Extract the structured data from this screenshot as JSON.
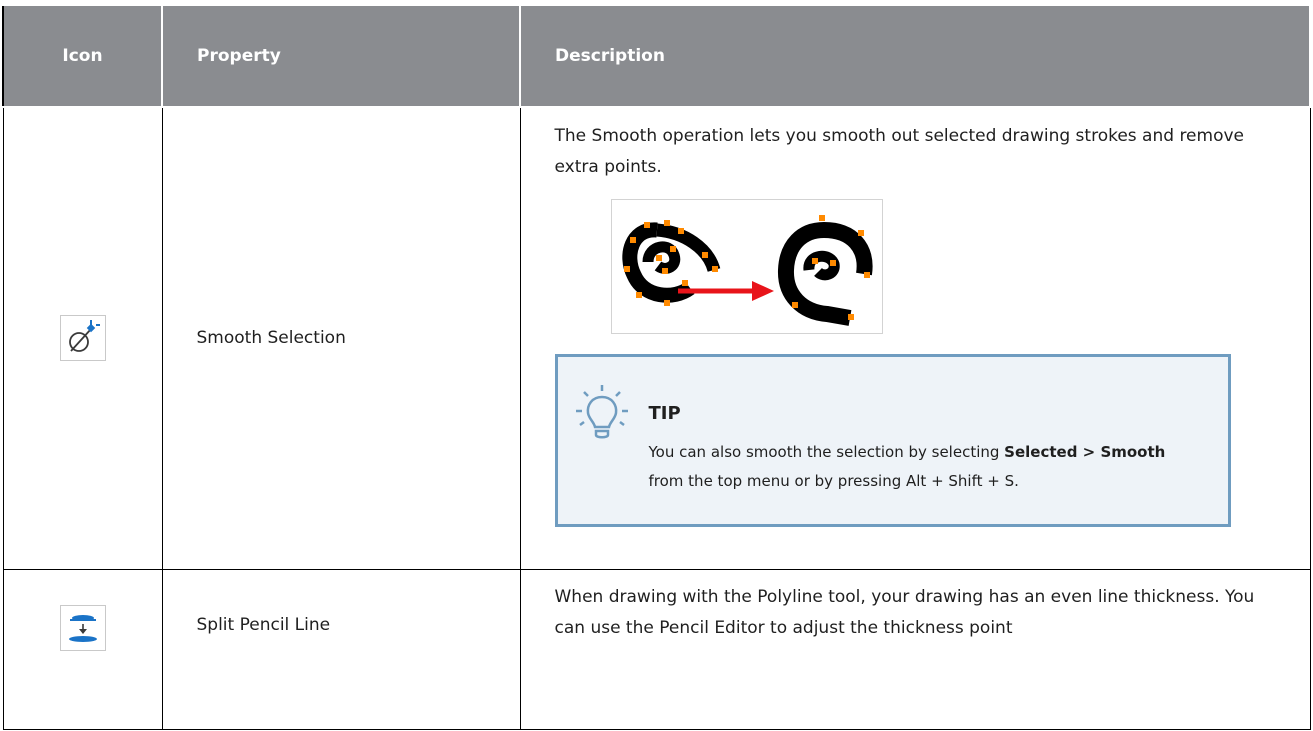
{
  "table": {
    "headers": {
      "icon": "Icon",
      "property": "Property",
      "description": "Description"
    },
    "rows": [
      {
        "icon": "smooth-selection-icon",
        "property": "Smooth Selection",
        "description": "The Smooth operation lets you smooth out selected drawing strokes and remove extra points.",
        "tip": {
          "title": "TIP",
          "text_before": "You can also smooth the selection by selecting ",
          "menu_path": "Selected > Smooth",
          "text_after": " from the top menu or by pressing Alt + Shift + S."
        }
      },
      {
        "icon": "split-pencil-line-icon",
        "property": "Split Pencil Line",
        "description": "When drawing with the Polyline tool, your drawing has an even line thickness. You can use the Pencil Editor to adjust the thickness point"
      }
    ]
  },
  "colors": {
    "header_bg": "#8a8c90",
    "tip_bg": "#eef3f8",
    "tip_border": "#6f9cc0",
    "icon_blue": "#1a73c7",
    "arrow_red": "#e8141a",
    "point_orange": "#ff8a00"
  }
}
